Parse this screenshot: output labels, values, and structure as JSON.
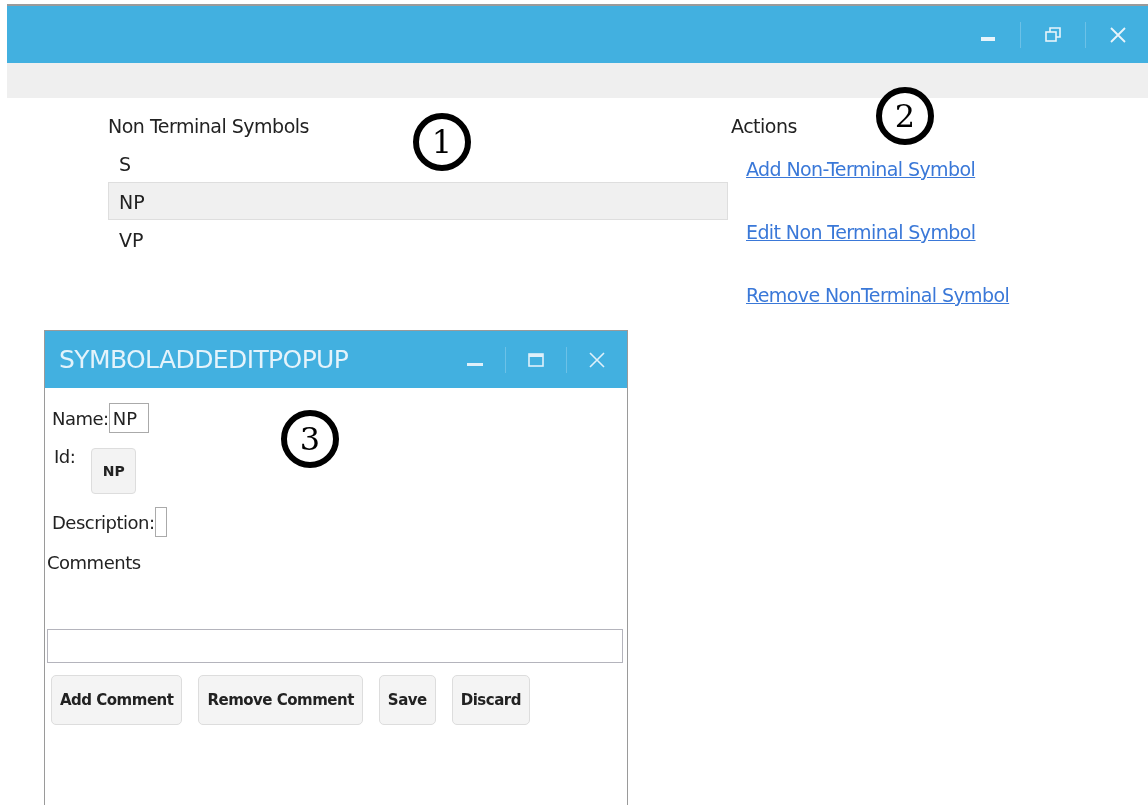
{
  "main_window": {
    "controls": [
      {
        "kind": "minimize"
      },
      {
        "kind": "restore"
      },
      {
        "kind": "close"
      }
    ]
  },
  "symbols": {
    "heading": "Non Terminal Symbols",
    "items": [
      {
        "label": "S",
        "selected": false
      },
      {
        "label": "NP",
        "selected": true
      },
      {
        "label": "VP",
        "selected": false
      }
    ]
  },
  "actions": {
    "heading": "Actions",
    "links": [
      "Add Non-Terminal Symbol",
      "Edit Non Terminal Symbol",
      "Remove NonTerminal Symbol"
    ]
  },
  "popup": {
    "title": "SYMBOLADDEDITPOPUP",
    "controls": [
      {
        "kind": "minimize"
      },
      {
        "kind": "maximize"
      },
      {
        "kind": "close"
      }
    ],
    "name_label": "Name:",
    "name_value": "NP",
    "id_label": "Id:",
    "id_value": "NP",
    "description_label": "Description:",
    "comments_label": "Comments",
    "buttons": [
      "Add Comment",
      "Remove Comment",
      "Save",
      "Discard"
    ]
  },
  "callouts": [
    "1",
    "2",
    "3"
  ]
}
